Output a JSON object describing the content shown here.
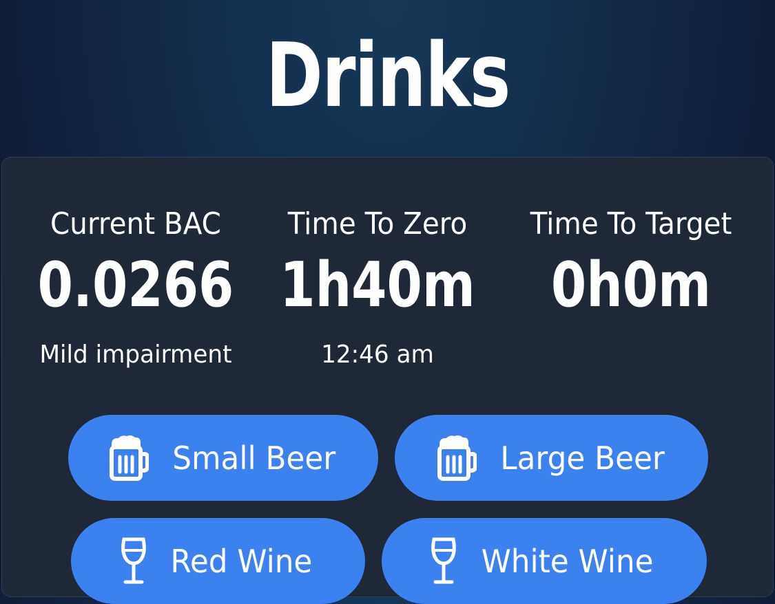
{
  "header": {
    "title": "Drinks"
  },
  "stats": {
    "bac": {
      "label": "Current BAC",
      "value": "0.0266",
      "sub": "Mild impairment"
    },
    "zero": {
      "label": "Time To Zero",
      "value": "1h40m",
      "sub": "12:46 am"
    },
    "target": {
      "label": "Time To Target",
      "value": "0h0m",
      "sub": ""
    }
  },
  "buttons": [
    {
      "label": "Small Beer",
      "icon": "beer-mug-icon"
    },
    {
      "label": "Large Beer",
      "icon": "beer-mug-icon"
    },
    {
      "label": "Red Wine",
      "icon": "wine-glass-icon"
    },
    {
      "label": "White Wine",
      "icon": "wine-glass-icon"
    }
  ],
  "colors": {
    "accent": "#3b82f0",
    "panel": "#1f2836",
    "background": "#13294a"
  }
}
